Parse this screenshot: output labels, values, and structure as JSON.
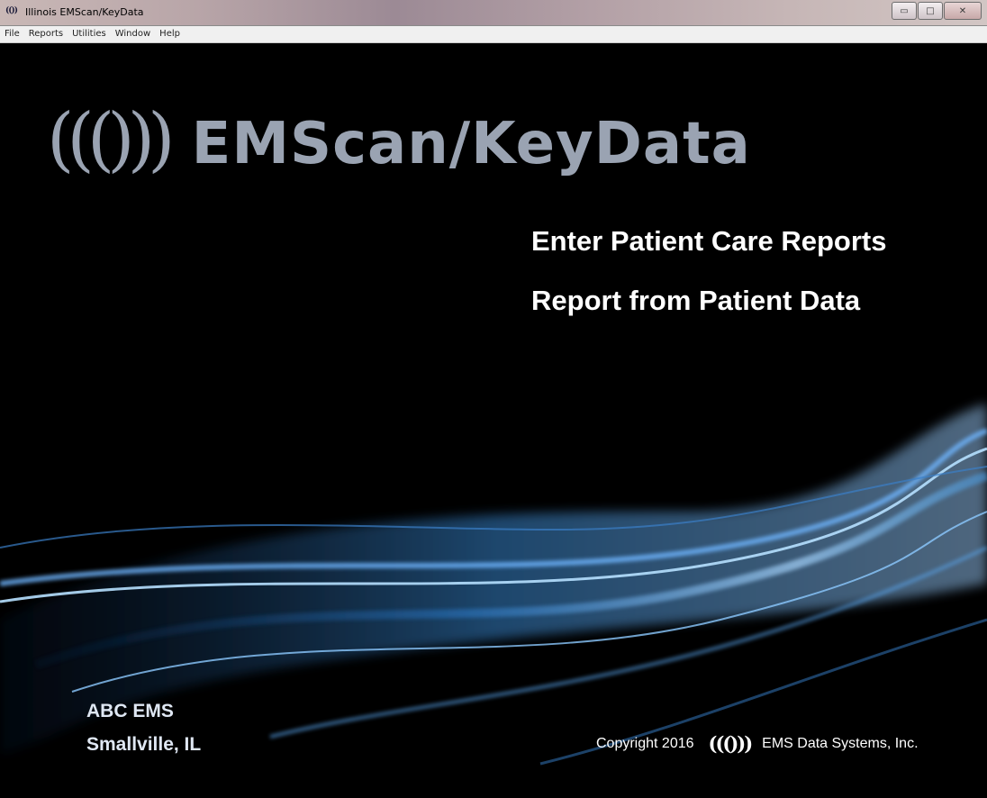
{
  "window": {
    "title": "Illinois EMScan/KeyData",
    "icon": "(())",
    "controls": {
      "minimize": "▭",
      "maximize": "□",
      "close": "✕"
    }
  },
  "menu": {
    "items": [
      "File",
      "Reports",
      "Utilities",
      "Window",
      "Help"
    ]
  },
  "main": {
    "logo_icon": "((()))",
    "logo_text": "EMScan/KeyData",
    "links": [
      "Enter Patient Care Reports",
      "Report from Patient Data"
    ],
    "org_name": "ABC EMS",
    "org_city": "Smallville, IL",
    "copyright": "Copyright 2016",
    "footer_icon": "((()))",
    "company": "EMS Data Systems, Inc."
  }
}
